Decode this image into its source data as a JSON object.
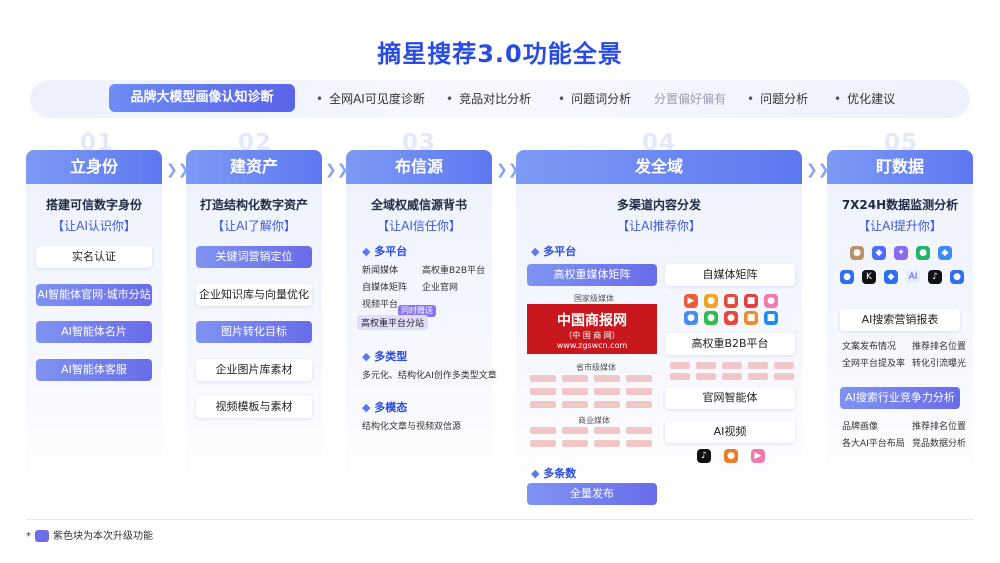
{
  "title": "摘星搜荐3.0功能全景",
  "diagnosis": {
    "main": "品牌大模型画像认知诊断",
    "items": [
      "全网AI可见度诊断",
      "竞品对比分析",
      "问题词分析",
      "分置偏好偏有",
      "问题分析",
      "优化建议"
    ]
  },
  "columns": [
    {
      "num": "01",
      "head": "立身份",
      "sub": "搭建可信数字身份",
      "tag": "【让AI认识你】",
      "items": [
        "实名认证",
        "AI智能体官网·城市分站",
        "AI智能体名片",
        "AI智能体客服"
      ]
    },
    {
      "num": "02",
      "head": "建资产",
      "sub": "打造结构化数字资产",
      "tag": "【让AI了解你】",
      "items": [
        "关键词营销定位",
        "企业知识库与向量优化",
        "图片转化目标",
        "企业图片库素材",
        "视频模板与素材"
      ]
    },
    {
      "num": "03",
      "head": "布信源",
      "sub": "全域权威信源背书",
      "tag": "【让AI信任你】",
      "sec1": "多平台",
      "platforms": [
        "新闻媒体",
        "高权重B2B平台",
        "自媒体矩阵",
        "企业官网",
        "视频平台",
        "高权重平台分站"
      ],
      "badge": "同时赠送",
      "sec2": "多类型",
      "type_text": "多元化、结构化AI创作多类型文章",
      "sec3": "多模态",
      "modal_text": "结构化文章与视频双信源"
    },
    {
      "num": "04",
      "head": "发全域",
      "sub": "多渠道内容分发",
      "tag": "【让AI推荐你】",
      "sec1": "多平台",
      "left_pill": "高权重媒体矩阵",
      "national": "国家级媒体",
      "logo": {
        "l1": "中国商报网",
        "l2": "（中 国 商 网）",
        "l3": "www.zgswcn.com"
      },
      "provincial": "省市级媒体",
      "business": "商业媒体",
      "right_items": [
        "自媒体矩阵",
        "高权重B2B平台",
        "官网智能体",
        "AI视频"
      ],
      "sec2": "多条数",
      "bottom_pill": "全量发布"
    },
    {
      "num": "05",
      "head": "盯数据",
      "sub": "7X24H数据监测分析",
      "tag": "【让AI提升你】",
      "pill1": "AI搜索营销报表",
      "list1": [
        "文案发布情况",
        "推荐排名位置",
        "全网平台提及率",
        "转化引流曝光"
      ],
      "pill2": "AI搜索行业竞争力分析",
      "list2": [
        "品牌画像",
        "推荐排名位置",
        "各大AI平台布局",
        "竞品数据分析"
      ]
    }
  ],
  "note": "紫色块为本次升级功能"
}
